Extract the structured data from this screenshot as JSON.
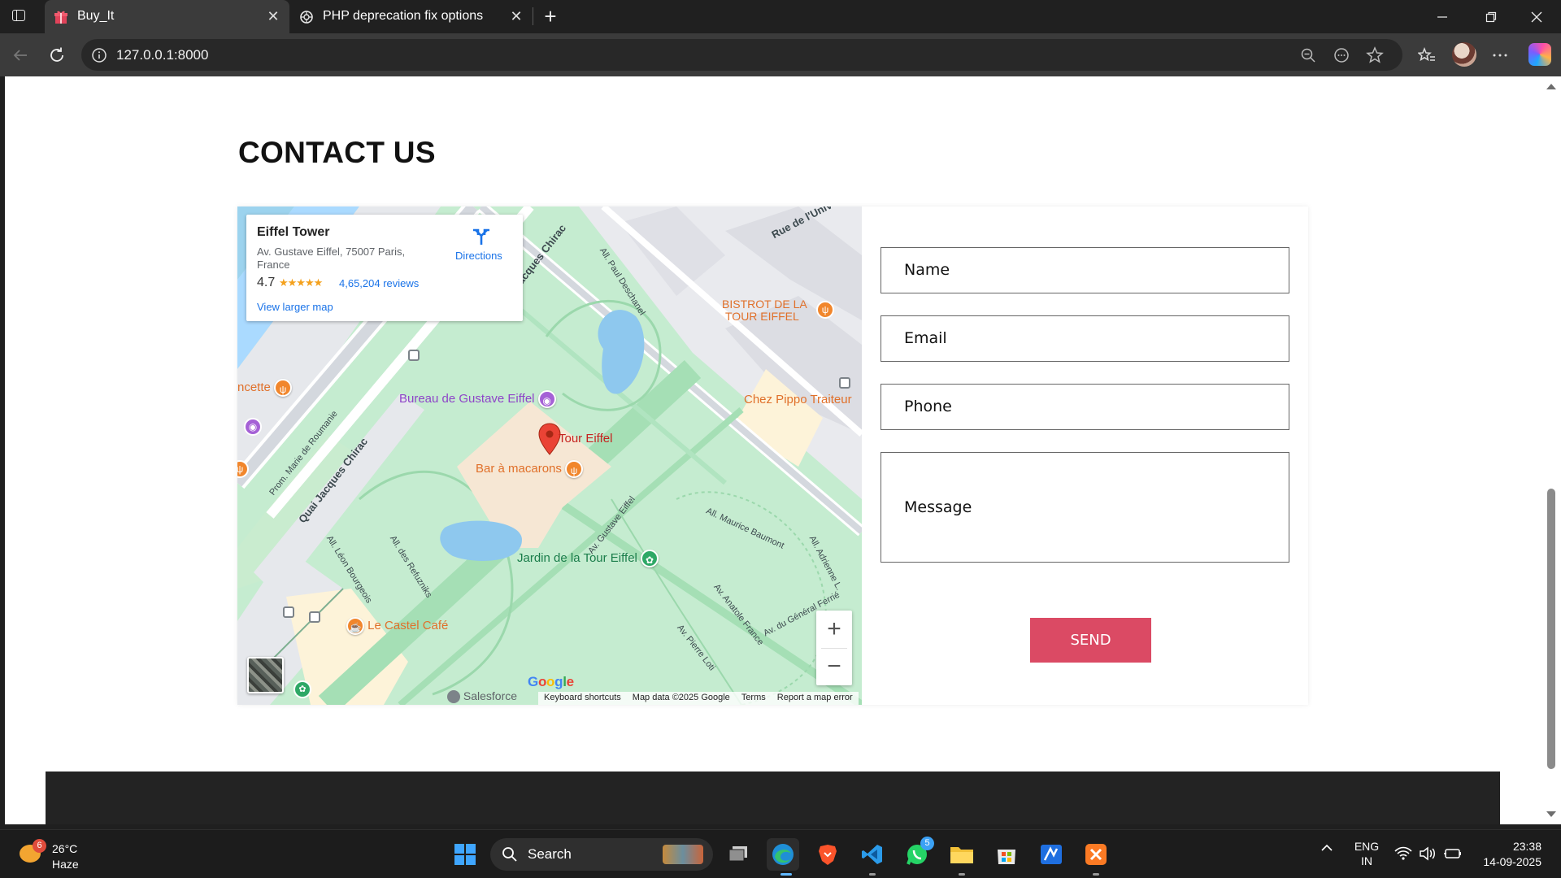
{
  "browser": {
    "tabs": [
      {
        "title": "Buy_It",
        "active": true,
        "favicon": "gift-icon"
      },
      {
        "title": "PHP deprecation fix options",
        "active": false,
        "favicon": "openai-icon"
      }
    ],
    "url": "127.0.0.1:8000"
  },
  "page": {
    "heading": "CONTACT US",
    "map": {
      "place_name": "Eiffel Tower",
      "address": "Av. Gustave Eiffel, 75007 Paris, France",
      "rating": "4.7",
      "reviews": "4,65,204 reviews",
      "directions": "Directions",
      "view_larger": "View larger map",
      "labels": {
        "tour_eiffel": "Tour Eiffel",
        "bureau": "Bureau de Gustave Eiffel",
        "macarons": "Bar à macarons",
        "jardin": "Jardin de la Tour Eiffel",
        "castel": "Le Castel Café",
        "bistrot_1": "BISTROT DE LA",
        "bistrot_2": "TOUR EIFFEL",
        "pippo": "Chez Pippo Traiteur",
        "ncette": "ncette",
        "salesforce": "Salesforce",
        "quai": "Quai Jacques Chirac",
        "quai_top": "Jacques Chirac",
        "rue_univ": "Rue de l'Univ",
        "paul_deschanel": "All. Paul Deschanel",
        "marie_roumanie": "Prom. Marie de Roumanie",
        "leon_bourgeois": "All. Léon Bourgeois",
        "refuzniks": "All. des Refuzniks",
        "gustave_eiffel": "Av. Gustave Eiffel",
        "maurice_baumont": "All. Maurice Baumont",
        "adrienne": "All. Adrienne L.",
        "anatole": "Av. Anatole France",
        "general_ferrie": "Av. du Général Ferrié",
        "pierre_loti": "Av. Pierre Loti"
      },
      "google_logo": "Google",
      "attribution": [
        "Keyboard shortcuts",
        "Map data ©2025 Google",
        "Terms",
        "Report a map error"
      ]
    },
    "form": {
      "name": "Name",
      "email": "Email",
      "phone": "Phone",
      "message": "Message",
      "send": "SEND"
    }
  },
  "taskbar": {
    "weather": {
      "temp": "26°C",
      "condition": "Haze",
      "badge": "6"
    },
    "search": "Search",
    "whatsapp_badge": "5",
    "lang_1": "ENG",
    "lang_2": "IN",
    "time": "23:38",
    "date": "14-09-2025"
  },
  "colors": {
    "accent": "#db4a64",
    "map_park": "#c5ecd0",
    "browser_bg": "#202020"
  }
}
